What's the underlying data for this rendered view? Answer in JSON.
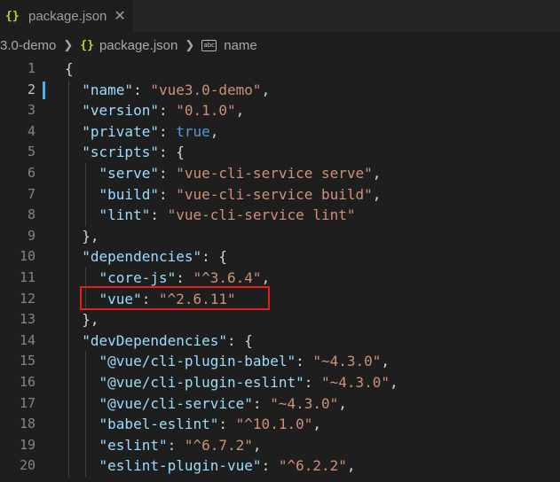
{
  "tab": {
    "icon": "{}",
    "label": "package.json",
    "close": "✕"
  },
  "breadcrumb": {
    "folder": "3.0-demo",
    "file": "package.json",
    "symbol": "name",
    "abc": "abc"
  },
  "code": [
    {
      "n": "1",
      "parts": [
        [
          "p",
          "{"
        ]
      ]
    },
    {
      "n": "2",
      "parts": [
        [
          "p",
          "  "
        ],
        [
          "k",
          "\"name\""
        ],
        [
          "p",
          ": "
        ],
        [
          "s",
          "\"vue3.0-demo\""
        ],
        [
          "p",
          ","
        ]
      ]
    },
    {
      "n": "3",
      "parts": [
        [
          "p",
          "  "
        ],
        [
          "k",
          "\"version\""
        ],
        [
          "p",
          ": "
        ],
        [
          "s",
          "\"0.1.0\""
        ],
        [
          "p",
          ","
        ]
      ]
    },
    {
      "n": "4",
      "parts": [
        [
          "p",
          "  "
        ],
        [
          "k",
          "\"private\""
        ],
        [
          "p",
          ": "
        ],
        [
          "b",
          "true"
        ],
        [
          "p",
          ","
        ]
      ]
    },
    {
      "n": "5",
      "parts": [
        [
          "p",
          "  "
        ],
        [
          "k",
          "\"scripts\""
        ],
        [
          "p",
          ": {"
        ]
      ]
    },
    {
      "n": "6",
      "parts": [
        [
          "p",
          "    "
        ],
        [
          "k",
          "\"serve\""
        ],
        [
          "p",
          ": "
        ],
        [
          "s",
          "\"vue-cli-service serve\""
        ],
        [
          "p",
          ","
        ]
      ]
    },
    {
      "n": "7",
      "parts": [
        [
          "p",
          "    "
        ],
        [
          "k",
          "\"build\""
        ],
        [
          "p",
          ": "
        ],
        [
          "s",
          "\"vue-cli-service build\""
        ],
        [
          "p",
          ","
        ]
      ]
    },
    {
      "n": "8",
      "parts": [
        [
          "p",
          "    "
        ],
        [
          "k",
          "\"lint\""
        ],
        [
          "p",
          ": "
        ],
        [
          "s",
          "\"vue-cli-service lint\""
        ]
      ]
    },
    {
      "n": "9",
      "parts": [
        [
          "p",
          "  },"
        ]
      ]
    },
    {
      "n": "10",
      "parts": [
        [
          "p",
          "  "
        ],
        [
          "k",
          "\"dependencies\""
        ],
        [
          "p",
          ": {"
        ]
      ]
    },
    {
      "n": "11",
      "parts": [
        [
          "p",
          "    "
        ],
        [
          "k",
          "\"core-js\""
        ],
        [
          "p",
          ": "
        ],
        [
          "s",
          "\"^3.6.4\""
        ],
        [
          "p",
          ","
        ]
      ]
    },
    {
      "n": "12",
      "parts": [
        [
          "p",
          "    "
        ],
        [
          "k",
          "\"vue\""
        ],
        [
          "p",
          ": "
        ],
        [
          "s",
          "\"^2.6.11\""
        ]
      ]
    },
    {
      "n": "13",
      "parts": [
        [
          "p",
          "  },"
        ]
      ]
    },
    {
      "n": "14",
      "parts": [
        [
          "p",
          "  "
        ],
        [
          "k",
          "\"devDependencies\""
        ],
        [
          "p",
          ": {"
        ]
      ]
    },
    {
      "n": "15",
      "parts": [
        [
          "p",
          "    "
        ],
        [
          "k",
          "\"@vue/cli-plugin-babel\""
        ],
        [
          "p",
          ": "
        ],
        [
          "s",
          "\"~4.3.0\""
        ],
        [
          "p",
          ","
        ]
      ]
    },
    {
      "n": "16",
      "parts": [
        [
          "p",
          "    "
        ],
        [
          "k",
          "\"@vue/cli-plugin-eslint\""
        ],
        [
          "p",
          ": "
        ],
        [
          "s",
          "\"~4.3.0\""
        ],
        [
          "p",
          ","
        ]
      ]
    },
    {
      "n": "17",
      "parts": [
        [
          "p",
          "    "
        ],
        [
          "k",
          "\"@vue/cli-service\""
        ],
        [
          "p",
          ": "
        ],
        [
          "s",
          "\"~4.3.0\""
        ],
        [
          "p",
          ","
        ]
      ]
    },
    {
      "n": "18",
      "parts": [
        [
          "p",
          "    "
        ],
        [
          "k",
          "\"babel-eslint\""
        ],
        [
          "p",
          ": "
        ],
        [
          "s",
          "\"^10.1.0\""
        ],
        [
          "p",
          ","
        ]
      ]
    },
    {
      "n": "19",
      "parts": [
        [
          "p",
          "    "
        ],
        [
          "k",
          "\"eslint\""
        ],
        [
          "p",
          ": "
        ],
        [
          "s",
          "\"^6.7.2\""
        ],
        [
          "p",
          ","
        ]
      ]
    },
    {
      "n": "20",
      "parts": [
        [
          "p",
          "    "
        ],
        [
          "k",
          "\"eslint-plugin-vue\""
        ],
        [
          "p",
          ": "
        ],
        [
          "s",
          "\"^6.2.2\""
        ],
        [
          "p",
          ","
        ]
      ]
    }
  ],
  "active_line": "2",
  "highlighted_line": "12"
}
